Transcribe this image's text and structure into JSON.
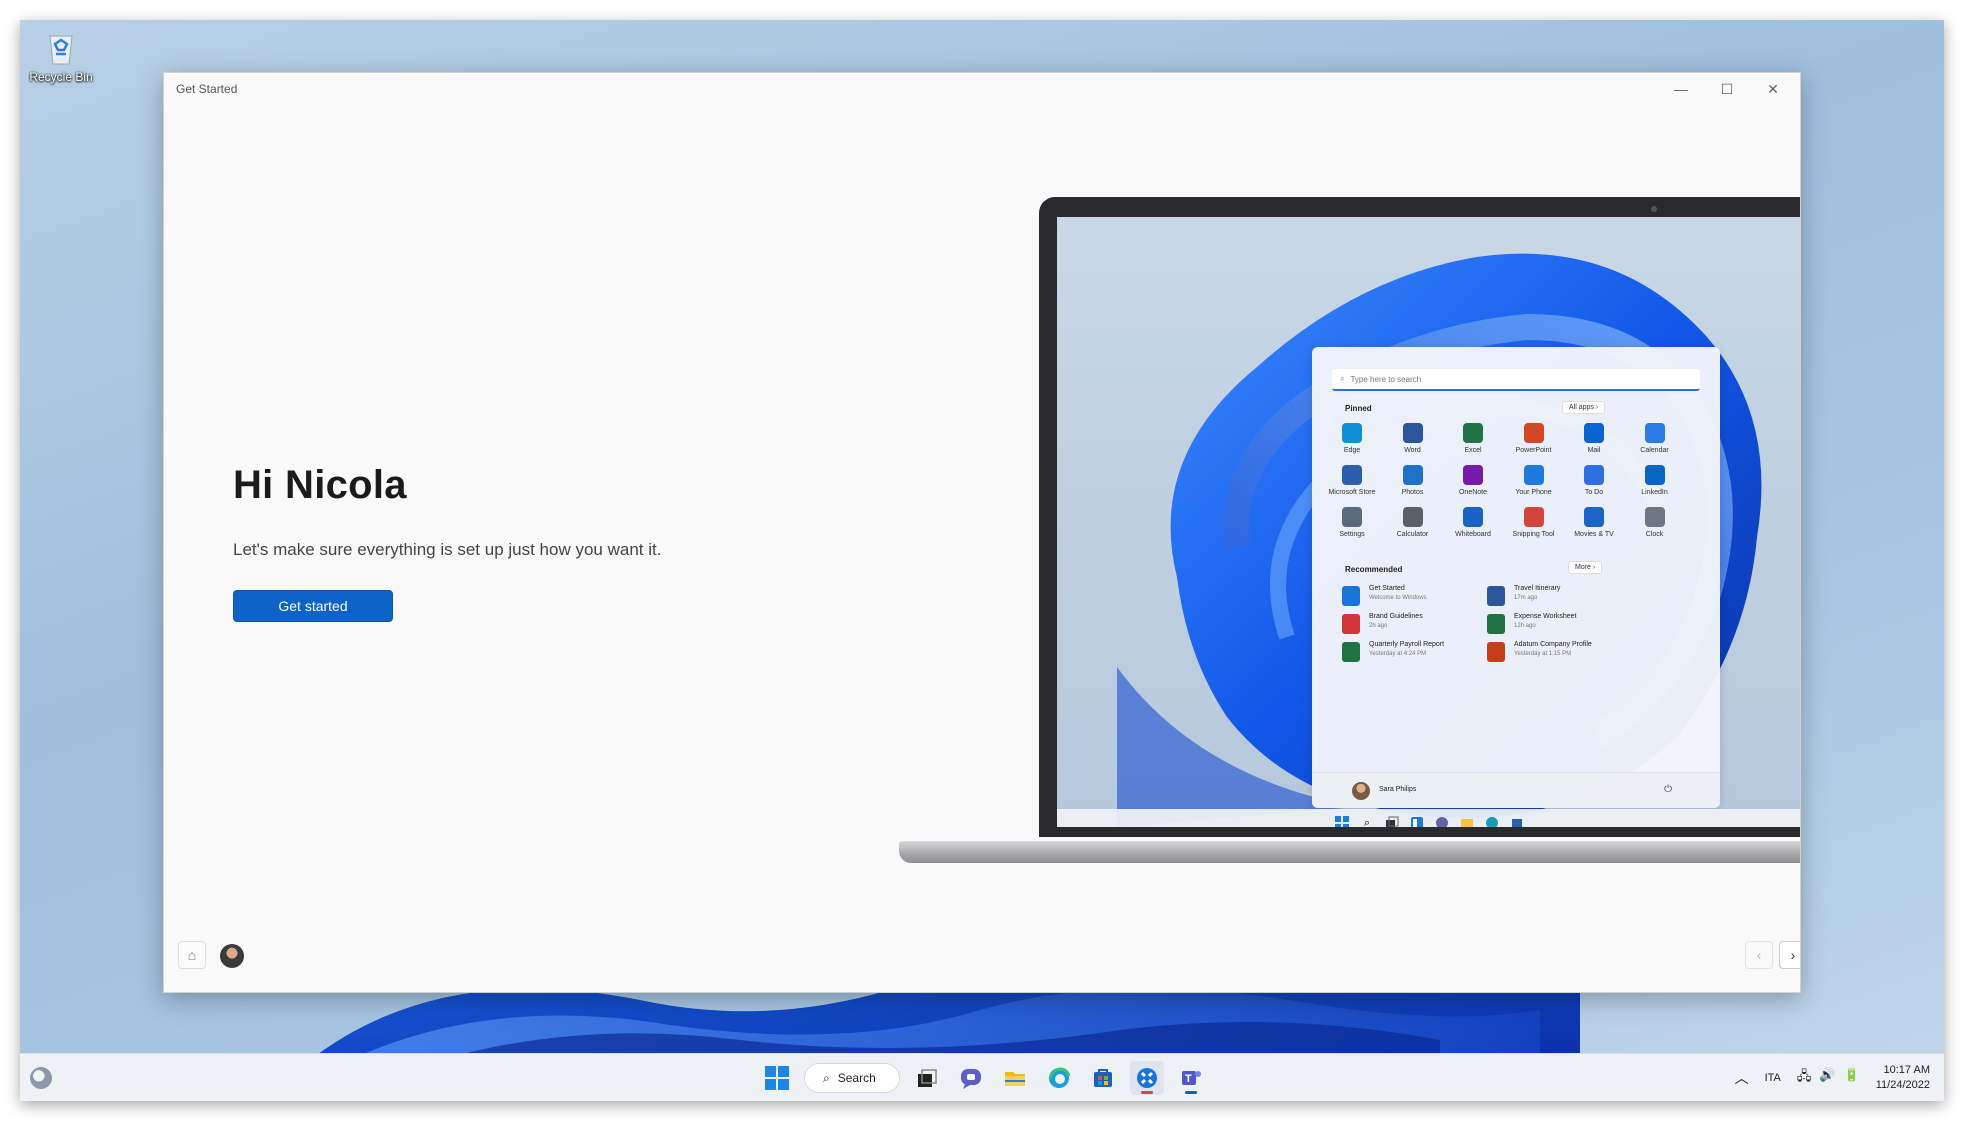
{
  "desktop": {
    "recycle_bin_label": "Recycle Bin"
  },
  "window": {
    "title": "Get Started",
    "controls": {
      "minimize": "—",
      "maximize": "☐",
      "close": "✕"
    }
  },
  "hero": {
    "greeting": "Hi Nicola",
    "subtitle": "Let's make sure everything is set up just how you want it.",
    "cta_label": "Get started"
  },
  "start_menu": {
    "search_placeholder": "Type here to search",
    "pinned_label": "Pinned",
    "all_apps_label": "All apps",
    "pinned_apps": [
      {
        "name": "Edge",
        "icon": "edge-icon",
        "color": "#0f8fd6"
      },
      {
        "name": "Word",
        "icon": "word-icon",
        "color": "#2b579a"
      },
      {
        "name": "Excel",
        "icon": "excel-icon",
        "color": "#217346"
      },
      {
        "name": "PowerPoint",
        "icon": "powerpoint-icon",
        "color": "#d24726"
      },
      {
        "name": "Mail",
        "icon": "mail-icon",
        "color": "#0a64d1"
      },
      {
        "name": "Calendar",
        "icon": "calendar-icon",
        "color": "#2c7be5"
      },
      {
        "name": "Microsoft Store",
        "icon": "store-icon",
        "color": "#2d5fa8"
      },
      {
        "name": "Photos",
        "icon": "photos-icon",
        "color": "#1e73c8"
      },
      {
        "name": "OneNote",
        "icon": "onenote-icon",
        "color": "#7719aa"
      },
      {
        "name": "Your Phone",
        "icon": "phone-icon",
        "color": "#1f7ae0"
      },
      {
        "name": "To Do",
        "icon": "todo-icon",
        "color": "#2f6fe0"
      },
      {
        "name": "LinkedIn",
        "icon": "linkedin-icon",
        "color": "#0a66c2"
      },
      {
        "name": "Settings",
        "icon": "settings-icon",
        "color": "#5a6a7a"
      },
      {
        "name": "Calculator",
        "icon": "calculator-icon",
        "color": "#5b5f66"
      },
      {
        "name": "Whiteboard",
        "icon": "whiteboard-icon",
        "color": "#1a62c4"
      },
      {
        "name": "Snipping Tool",
        "icon": "snipping-icon",
        "color": "#d1453b"
      },
      {
        "name": "Movies & TV",
        "icon": "movies-icon",
        "color": "#1e64c8"
      },
      {
        "name": "Clock",
        "icon": "clock-icon",
        "color": "#6d7682"
      }
    ],
    "recommended_label": "Recommended",
    "more_label": "More",
    "recommended": [
      {
        "title": "Get Started",
        "subtitle": "Welcome to Windows",
        "icon": "getstarted-icon",
        "color": "#1a73d6"
      },
      {
        "title": "Travel Itinerary",
        "subtitle": "17m ago",
        "icon": "word-doc-icon",
        "color": "#2b579a"
      },
      {
        "title": "Brand Guidelines",
        "subtitle": "2h ago",
        "icon": "pdf-icon",
        "color": "#d13438"
      },
      {
        "title": "Expense Worksheet",
        "subtitle": "12h ago",
        "icon": "excel-doc-icon",
        "color": "#217346"
      },
      {
        "title": "Quarterly Payroll Report",
        "subtitle": "Yesterday at 4:24 PM",
        "icon": "excel-doc-icon",
        "color": "#217346"
      },
      {
        "title": "Adatum Company Profile",
        "subtitle": "Yesterday at 1:15 PM",
        "icon": "powerpoint-doc-icon",
        "color": "#c43e1c"
      }
    ],
    "user_name": "Sara Philips"
  },
  "taskbar": {
    "search_label": "Search",
    "language": "ITA",
    "time": "10:17 AM",
    "date": "11/24/2022",
    "accent": "#0067c0"
  }
}
